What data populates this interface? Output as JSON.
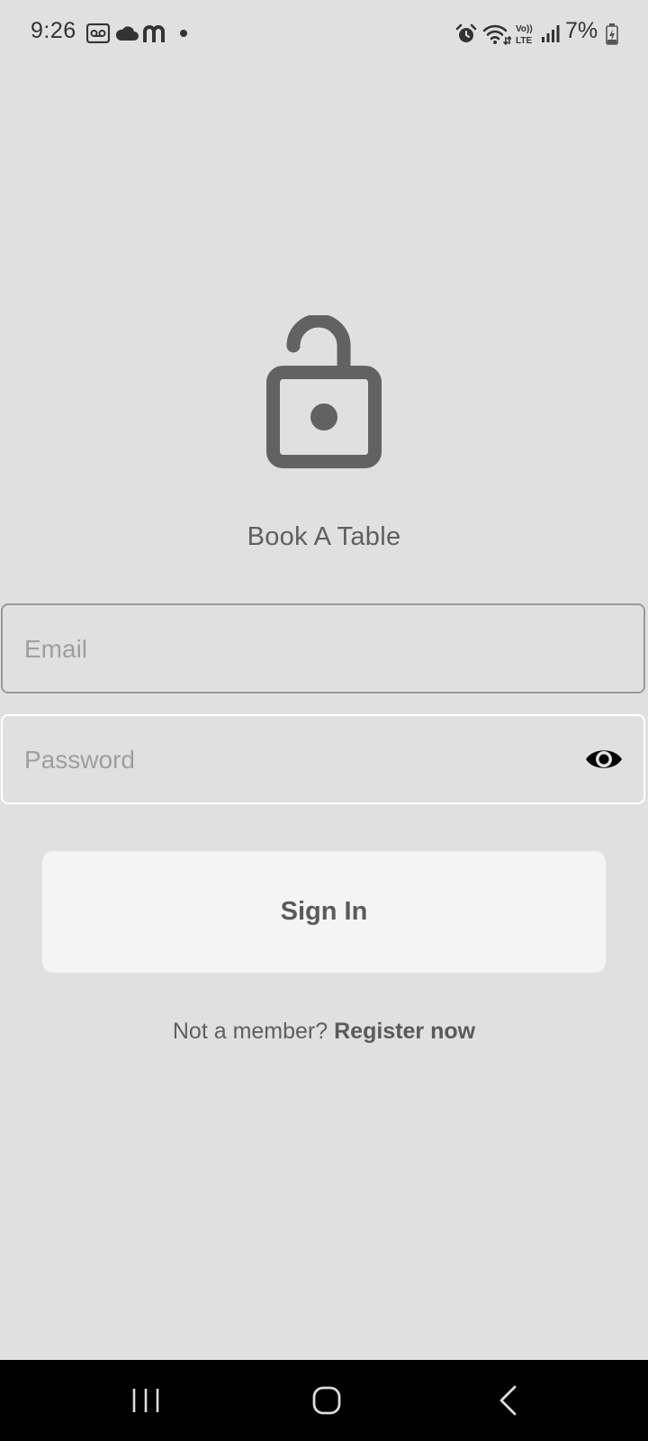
{
  "status_bar": {
    "time": "9:26",
    "battery_percent": "7%",
    "left_icons": [
      "voicemail-icon",
      "cloud-icon",
      "messenger-m-icon",
      "notification-dot-icon"
    ],
    "right_icons": [
      "alarm-icon",
      "wifi-icon",
      "volte-icon",
      "signal-icon",
      "battery-charging-icon"
    ],
    "volte_text": "Vo))\nLTE"
  },
  "app": {
    "icon": "lock-open-icon",
    "title": "Book A Table"
  },
  "form": {
    "email": {
      "placeholder": "Email",
      "value": ""
    },
    "password": {
      "placeholder": "Password",
      "value": "",
      "toggle_icon": "eye-icon"
    },
    "sign_in_label": "Sign In",
    "register_prompt": "Not a member? ",
    "register_link": "Register now"
  },
  "nav_bar": {
    "buttons": [
      "recent-apps-icon",
      "home-icon",
      "back-icon"
    ]
  },
  "colors": {
    "background": "#e0e0e0",
    "text_primary": "#5f5f5f",
    "button_bg": "#f4f4f4",
    "nav_bg": "#000000"
  }
}
